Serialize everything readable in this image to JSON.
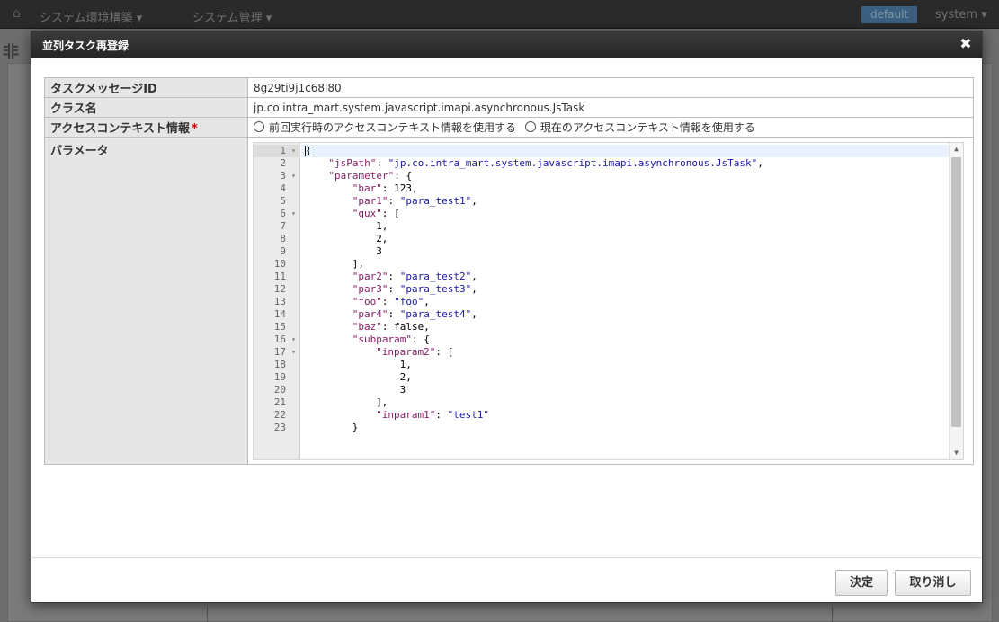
{
  "background": {
    "nav_menu_1": "システム環境構築 ▾",
    "nav_menu_2": "システム管理 ▾",
    "tenant_badge": "default",
    "user_menu": "system ▾",
    "page_title_char": "非"
  },
  "modal": {
    "title": "並列タスク再登録",
    "close_glyph": "✖"
  },
  "form": {
    "task_message_id": {
      "label": "タスクメッセージID",
      "value": "8g29ti9j1c68l80"
    },
    "class_name": {
      "label": "クラス名",
      "value": "jp.co.intra_mart.system.javascript.imapi.asynchronous.JsTask"
    },
    "access_context": {
      "label": "アクセスコンテキスト情報",
      "required_mark": "*",
      "options": [
        "前回実行時のアクセスコンテキスト情報を使用する",
        "現在のアクセスコンテキスト情報を使用する"
      ]
    },
    "parameter": {
      "label": "パラメータ"
    }
  },
  "editor": {
    "lines": [
      {
        "num": "1",
        "fold": true,
        "indent": 0,
        "parts": [
          [
            "n",
            "{"
          ]
        ]
      },
      {
        "num": "2",
        "fold": false,
        "indent": 4,
        "parts": [
          [
            "k",
            "\"jsPath\""
          ],
          [
            "n",
            ": "
          ],
          [
            "s",
            "\"jp.co.intra_mart.system.javascript.imapi.asynchronous.JsTask\""
          ],
          [
            "n",
            ","
          ]
        ]
      },
      {
        "num": "3",
        "fold": true,
        "indent": 4,
        "parts": [
          [
            "k",
            "\"parameter\""
          ],
          [
            "n",
            ": {"
          ]
        ]
      },
      {
        "num": "4",
        "fold": false,
        "indent": 8,
        "parts": [
          [
            "k",
            "\"bar\""
          ],
          [
            "n",
            ": 123,"
          ]
        ]
      },
      {
        "num": "5",
        "fold": false,
        "indent": 8,
        "parts": [
          [
            "k",
            "\"par1\""
          ],
          [
            "n",
            ": "
          ],
          [
            "s",
            "\"para_test1\""
          ],
          [
            "n",
            ","
          ]
        ]
      },
      {
        "num": "6",
        "fold": true,
        "indent": 8,
        "parts": [
          [
            "k",
            "\"qux\""
          ],
          [
            "n",
            ": ["
          ]
        ]
      },
      {
        "num": "7",
        "fold": false,
        "indent": 12,
        "parts": [
          [
            "n",
            "1,"
          ]
        ]
      },
      {
        "num": "8",
        "fold": false,
        "indent": 12,
        "parts": [
          [
            "n",
            "2,"
          ]
        ]
      },
      {
        "num": "9",
        "fold": false,
        "indent": 12,
        "parts": [
          [
            "n",
            "3"
          ]
        ]
      },
      {
        "num": "10",
        "fold": false,
        "indent": 8,
        "parts": [
          [
            "n",
            "],"
          ]
        ]
      },
      {
        "num": "11",
        "fold": false,
        "indent": 8,
        "parts": [
          [
            "k",
            "\"par2\""
          ],
          [
            "n",
            ": "
          ],
          [
            "s",
            "\"para_test2\""
          ],
          [
            "n",
            ","
          ]
        ]
      },
      {
        "num": "12",
        "fold": false,
        "indent": 8,
        "parts": [
          [
            "k",
            "\"par3\""
          ],
          [
            "n",
            ": "
          ],
          [
            "s",
            "\"para_test3\""
          ],
          [
            "n",
            ","
          ]
        ]
      },
      {
        "num": "13",
        "fold": false,
        "indent": 8,
        "parts": [
          [
            "k",
            "\"foo\""
          ],
          [
            "n",
            ": "
          ],
          [
            "s",
            "\"foo\""
          ],
          [
            "n",
            ","
          ]
        ]
      },
      {
        "num": "14",
        "fold": false,
        "indent": 8,
        "parts": [
          [
            "k",
            "\"par4\""
          ],
          [
            "n",
            ": "
          ],
          [
            "s",
            "\"para_test4\""
          ],
          [
            "n",
            ","
          ]
        ]
      },
      {
        "num": "15",
        "fold": false,
        "indent": 8,
        "parts": [
          [
            "k",
            "\"baz\""
          ],
          [
            "n",
            ": false,"
          ]
        ]
      },
      {
        "num": "16",
        "fold": true,
        "indent": 8,
        "parts": [
          [
            "k",
            "\"subparam\""
          ],
          [
            "n",
            ": {"
          ]
        ]
      },
      {
        "num": "17",
        "fold": true,
        "indent": 12,
        "parts": [
          [
            "k",
            "\"inparam2\""
          ],
          [
            "n",
            ": ["
          ]
        ]
      },
      {
        "num": "18",
        "fold": false,
        "indent": 16,
        "parts": [
          [
            "n",
            "1,"
          ]
        ]
      },
      {
        "num": "19",
        "fold": false,
        "indent": 16,
        "parts": [
          [
            "n",
            "2,"
          ]
        ]
      },
      {
        "num": "20",
        "fold": false,
        "indent": 16,
        "parts": [
          [
            "n",
            "3"
          ]
        ]
      },
      {
        "num": "21",
        "fold": false,
        "indent": 12,
        "parts": [
          [
            "n",
            "],"
          ]
        ]
      },
      {
        "num": "22",
        "fold": false,
        "indent": 12,
        "parts": [
          [
            "k",
            "\"inparam1\""
          ],
          [
            "n",
            ": "
          ],
          [
            "s",
            "\"test1\""
          ]
        ]
      },
      {
        "num": "23",
        "fold": false,
        "indent": 8,
        "parts": [
          [
            "n",
            "}"
          ]
        ]
      }
    ]
  },
  "footer": {
    "ok_label": "決定",
    "cancel_label": "取り消し"
  }
}
